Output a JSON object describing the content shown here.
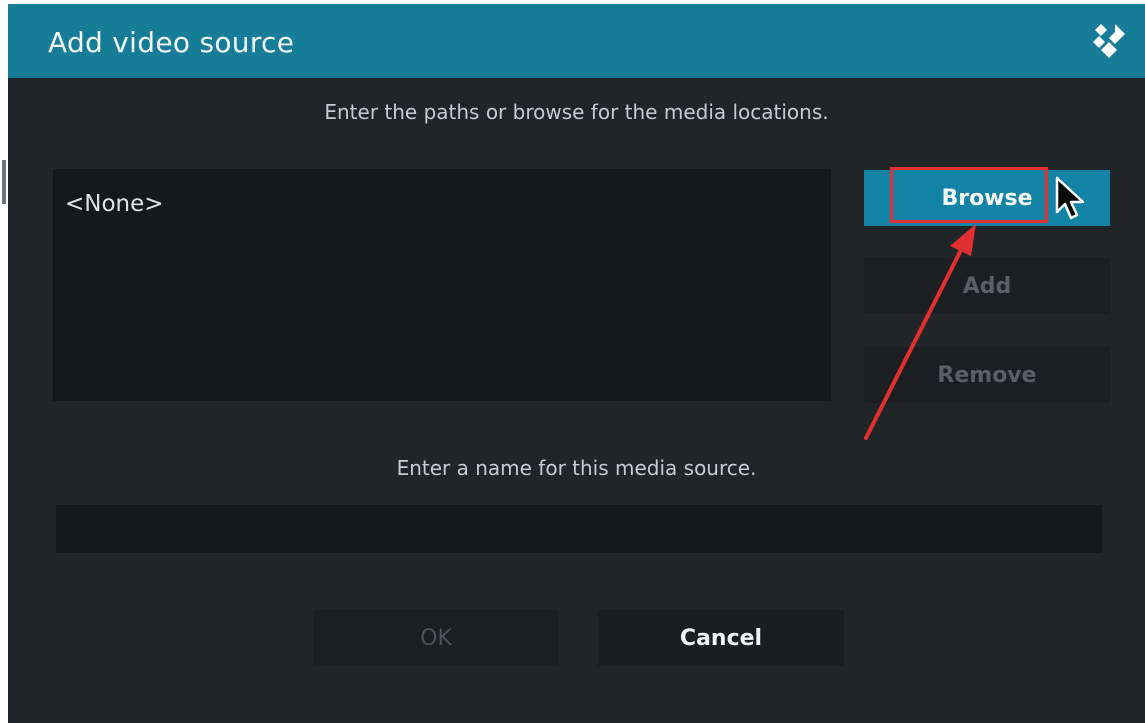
{
  "dialog": {
    "title": "Add video source",
    "logo_icon": "kodi-logo-icon",
    "instructions_paths": "Enter the paths or browse for the media locations.",
    "path_list": [
      "<None>"
    ],
    "buttons": {
      "browse": "Browse",
      "add": "Add",
      "remove": "Remove"
    },
    "instructions_name": "Enter a name for this media source.",
    "name_field": {
      "value": "",
      "placeholder": ""
    },
    "actions": {
      "ok": "OK",
      "cancel": "Cancel"
    }
  },
  "colors": {
    "titlebar": "#177c97",
    "background": "#212528",
    "focused_button": "#1383a6",
    "annotation": "#e23030"
  }
}
